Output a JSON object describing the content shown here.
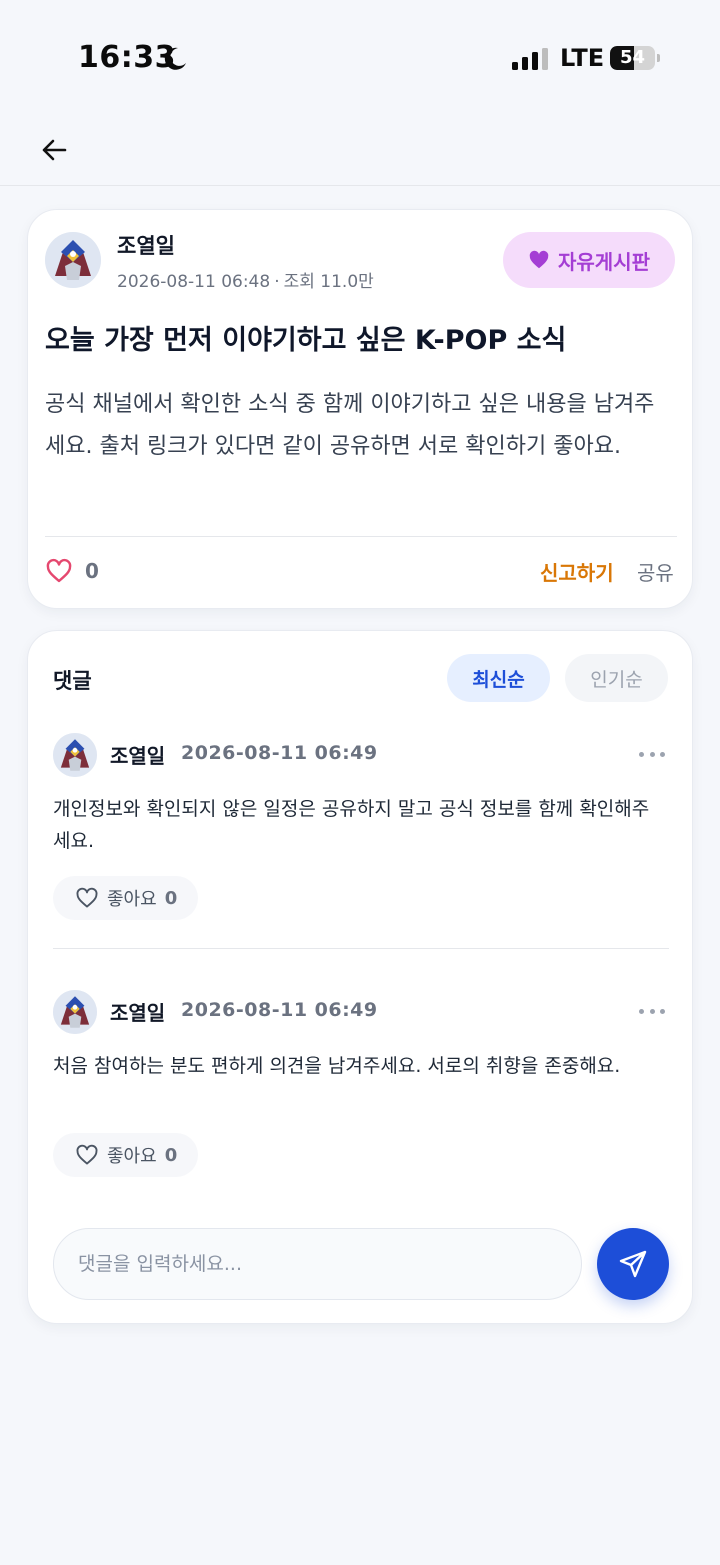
{
  "status_bar": {
    "time": "16:33",
    "network": "LTE",
    "battery": "54",
    "battery_level": 0.54
  },
  "header": {
    "back_icon": "arrow-left-icon"
  },
  "post": {
    "author": "조열일",
    "date": "2026-08-11 06:48",
    "meta_separator": "·",
    "views": "조회 11.0만",
    "category": "자유게시판",
    "category_color": "#a43ed4",
    "title": "오늘 가장 먼저 이야기하고 싶은 K-POP 소식",
    "body": "공식 채널에서 확인한 소식 중 함께 이야기하고 싶은 내용을 남겨주세요. 출처 링크가 있다면 같이 공유하면 서로 확인하기 좋아요.",
    "likes": "0",
    "report_label": "신고하기",
    "share_label": "공유"
  },
  "comments": {
    "title": "댓글",
    "sort_latest": "최신순",
    "sort_popular": "인기순",
    "items": [
      {
        "author": "조열일",
        "time": "2026-08-11 06:49",
        "text": "개인정보와 확인되지 않은 일정은 공유하지 말고 공식 정보를 함께 확인해주세요.",
        "like_label": "좋아요",
        "likes": "0"
      },
      {
        "author": "조열일",
        "time": "2026-08-11 06:49",
        "text": "처음 참여하는 분도 편하게 의견을 남겨주세요. 서로의 취향을 존중해요.",
        "like_label": "좋아요",
        "likes": "0"
      }
    ],
    "input_placeholder": "댓글을 입력하세요...",
    "send_icon": "send-icon"
  },
  "colors": {
    "accent": "#1d4ed8",
    "report": "#d97706",
    "like_heart": "#e5486f"
  }
}
